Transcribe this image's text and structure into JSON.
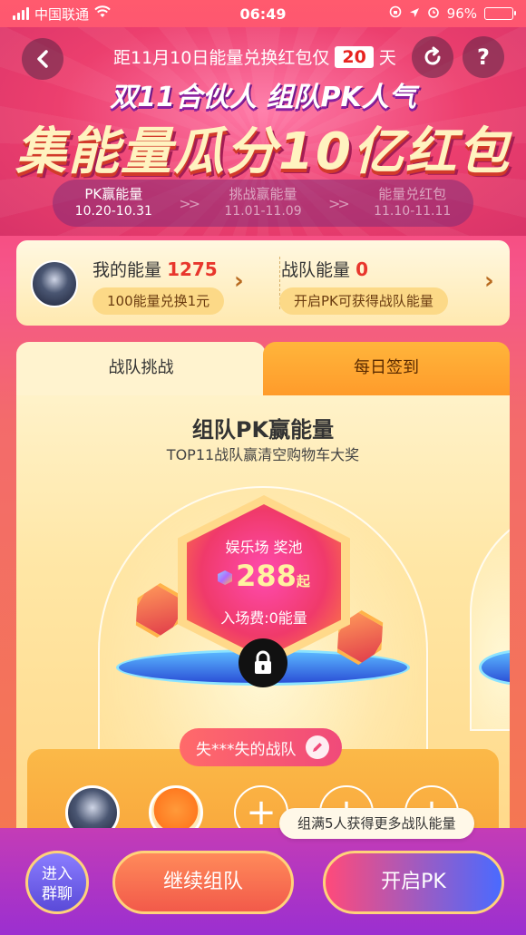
{
  "status_bar": {
    "carrier": "中国联通",
    "time": "06:49",
    "battery": "96%"
  },
  "header": {
    "countdown_prefix": "距11月10日能量兑换红包仅",
    "countdown_days": "20",
    "countdown_suffix": "天",
    "subtitle": "双11合伙人 组队PK人气",
    "title": "集能量瓜分10亿红包",
    "phases": [
      {
        "name": "PK赢能量",
        "dates": "10.20-10.31",
        "active": true
      },
      {
        "name": "挑战赢能量",
        "dates": "11.01-11.09",
        "active": false
      },
      {
        "name": "能量兑红包",
        "dates": "11.10-11.11",
        "active": false
      }
    ]
  },
  "energy": {
    "my_label": "我的能量",
    "my_value": "1275",
    "my_pill": "100能量兑换1元",
    "team_label": "战队能量",
    "team_value": "0",
    "team_pill": "开启PK可获得战队能量"
  },
  "tabs": {
    "team_challenge": "战队挑战",
    "daily_checkin": "每日签到"
  },
  "panel": {
    "title": "组队PK赢能量",
    "subtitle": "TOP11战队赢清空购物车大奖",
    "prize_name": "娱乐场 奖池",
    "prize_amount": "288",
    "prize_suffix": "起",
    "prize_fee": "入场费:0能量",
    "team_name": "失***失的战队"
  },
  "tooltip": "组满5人获得更多战队能量",
  "bottom": {
    "chat_line1": "进入",
    "chat_line2": "群聊",
    "continue_label": "继续组队",
    "pk_label": "开启PK"
  },
  "icons": {
    "back": "chevron-left-icon",
    "refresh": "refresh-icon",
    "help": "question-icon",
    "lock": "lock-icon",
    "edit": "pencil-icon",
    "add": "plus-icon"
  },
  "colors": {
    "accent_red": "#e8362c",
    "panel_bg": "#fff2c9",
    "bottom_bar": "#9b2fd0"
  }
}
